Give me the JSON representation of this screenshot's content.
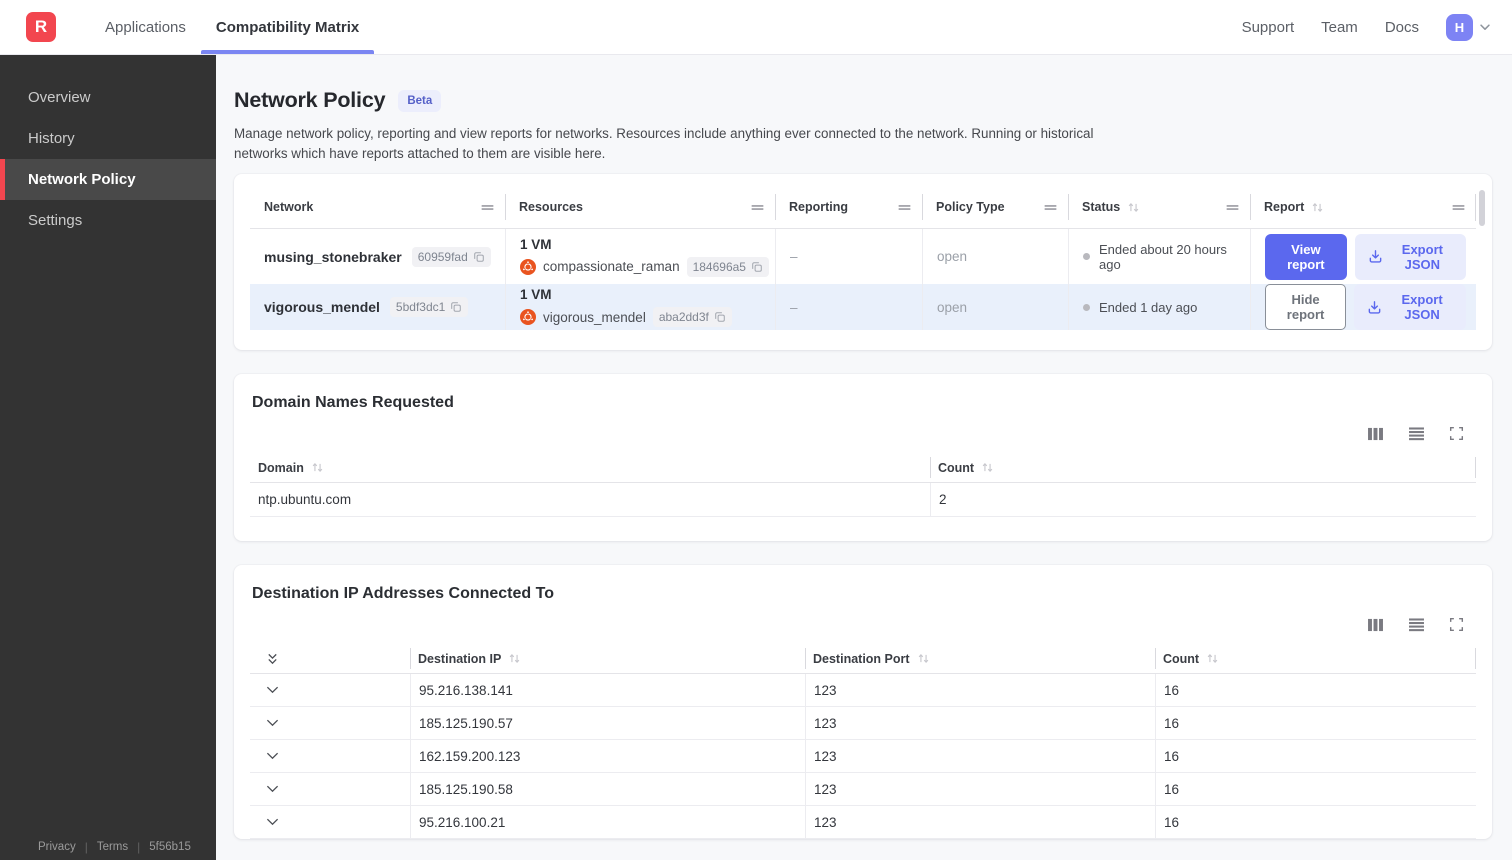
{
  "colors": {
    "brand-red": "#f2464f",
    "accent-indigo": "#5b68ee",
    "accent-indigo-light": "#e9ecfc",
    "tab-underline": "#7b86f2",
    "avatar-bg": "#7d83f4",
    "beta-bg": "#eceefc",
    "beta-text": "#5560c8",
    "ubuntu-orange": "#e95420",
    "row-selected": "#e9f0fb",
    "sidebar-bg": "#333333",
    "sidebar-active-bg": "#494949",
    "page-bg": "#f7f8fa",
    "status-dot": "#b9b9be"
  },
  "navbar": {
    "logo_letter": "R",
    "tabs": [
      {
        "label": "Applications"
      },
      {
        "label": "Compatibility Matrix"
      }
    ],
    "links": [
      {
        "label": "Support"
      },
      {
        "label": "Team"
      },
      {
        "label": "Docs"
      }
    ],
    "avatar_initial": "H"
  },
  "sidebar": {
    "items": [
      {
        "label": "Overview"
      },
      {
        "label": "History"
      },
      {
        "label": "Network Policy"
      },
      {
        "label": "Settings"
      }
    ],
    "footer": {
      "privacy": "Privacy",
      "terms": "Terms",
      "version": "5f56b15"
    }
  },
  "page": {
    "title": "Network Policy",
    "beta": "Beta",
    "description": "Manage network policy, reporting and view reports for networks. Resources include anything ever connected to the network. Running or historical networks which have reports attached to them are visible here."
  },
  "networks_table": {
    "columns": [
      {
        "label": "Network"
      },
      {
        "label": "Resources"
      },
      {
        "label": "Reporting"
      },
      {
        "label": "Policy Type"
      },
      {
        "label": "Status"
      },
      {
        "label": "Report"
      }
    ],
    "rows": [
      {
        "name": "musing_stonebraker",
        "network_id": "60959fad",
        "vm_count": "1 VM",
        "vm_name": "compassionate_raman",
        "vm_id": "184696a5",
        "reporting": "–",
        "policy_type": "open",
        "status": "Ended about 20 hours ago",
        "report_action": "View report",
        "export_label": "Export JSON"
      },
      {
        "name": "vigorous_mendel",
        "network_id": "5bdf3dc1",
        "vm_count": "1 VM",
        "vm_name": "vigorous_mendel",
        "vm_id": "aba2dd3f",
        "reporting": "–",
        "policy_type": "open",
        "status": "Ended 1 day ago",
        "report_action": "Hide report",
        "export_label": "Export JSON"
      }
    ]
  },
  "domains_card": {
    "title": "Domain Names Requested",
    "columns": [
      {
        "label": "Domain"
      },
      {
        "label": "Count"
      }
    ],
    "rows": [
      {
        "domain": "ntp.ubuntu.com",
        "count": "2"
      }
    ]
  },
  "destinations_card": {
    "title": "Destination IP Addresses Connected To",
    "columns": [
      {
        "label": "Destination IP"
      },
      {
        "label": "Destination Port"
      },
      {
        "label": "Count"
      }
    ],
    "rows": [
      {
        "ip": "95.216.138.141",
        "port": "123",
        "count": "16"
      },
      {
        "ip": "185.125.190.57",
        "port": "123",
        "count": "16"
      },
      {
        "ip": "162.159.200.123",
        "port": "123",
        "count": "16"
      },
      {
        "ip": "185.125.190.58",
        "port": "123",
        "count": "16"
      },
      {
        "ip": "95.216.100.21",
        "port": "123",
        "count": "16"
      }
    ]
  }
}
